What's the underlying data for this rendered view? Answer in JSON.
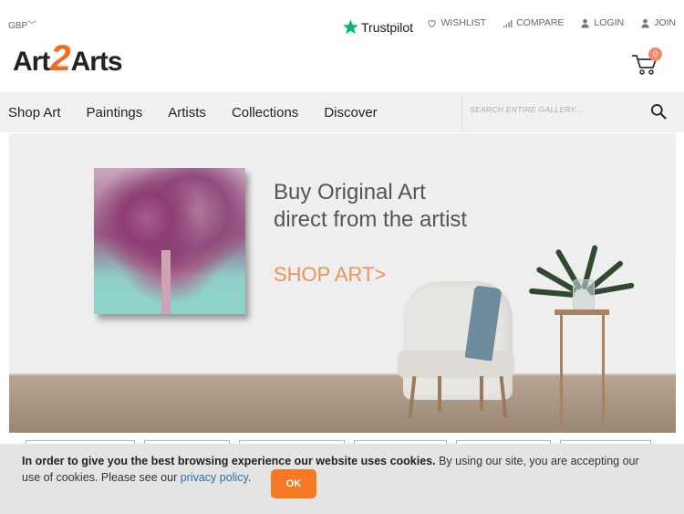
{
  "topbar": {
    "currency": "GBP",
    "trustpilot_label": "Trustpilot",
    "links": [
      {
        "label": "WISHLIST",
        "icon": "heart-icon"
      },
      {
        "label": "COMPARE",
        "icon": "bar-chart-icon"
      },
      {
        "label": "LOGIN",
        "icon": "user-icon"
      },
      {
        "label": "JOIN",
        "icon": "user-icon"
      }
    ]
  },
  "logo": {
    "part1": "Art",
    "part2": "2",
    "part3": "Arts"
  },
  "cart": {
    "count": "0",
    "icon": "cart-icon"
  },
  "nav": {
    "items": [
      "Shop Art",
      "Paintings",
      "Artists",
      "Collections",
      "Discover"
    ]
  },
  "search": {
    "placeholder": "SEARCH ENTIRE GALLERY...",
    "icon": "search-icon"
  },
  "hero": {
    "title_line1": "Buy Original Art",
    "title_line2": "direct from the artist",
    "cta": "SHOP ART>"
  },
  "cookie": {
    "bold_text": "In order to give you the best browsing experience our website uses cookies.",
    "text": " By using our site, you are accepting our use of cookies. Please see our ",
    "link_text": "privacy policy",
    "end_text": ".",
    "ok_label": "OK"
  },
  "colors": {
    "accent": "#f47a25",
    "cta": "#e5945a",
    "link": "#2b6fa8",
    "trustpilot_green": "#00b67a"
  }
}
